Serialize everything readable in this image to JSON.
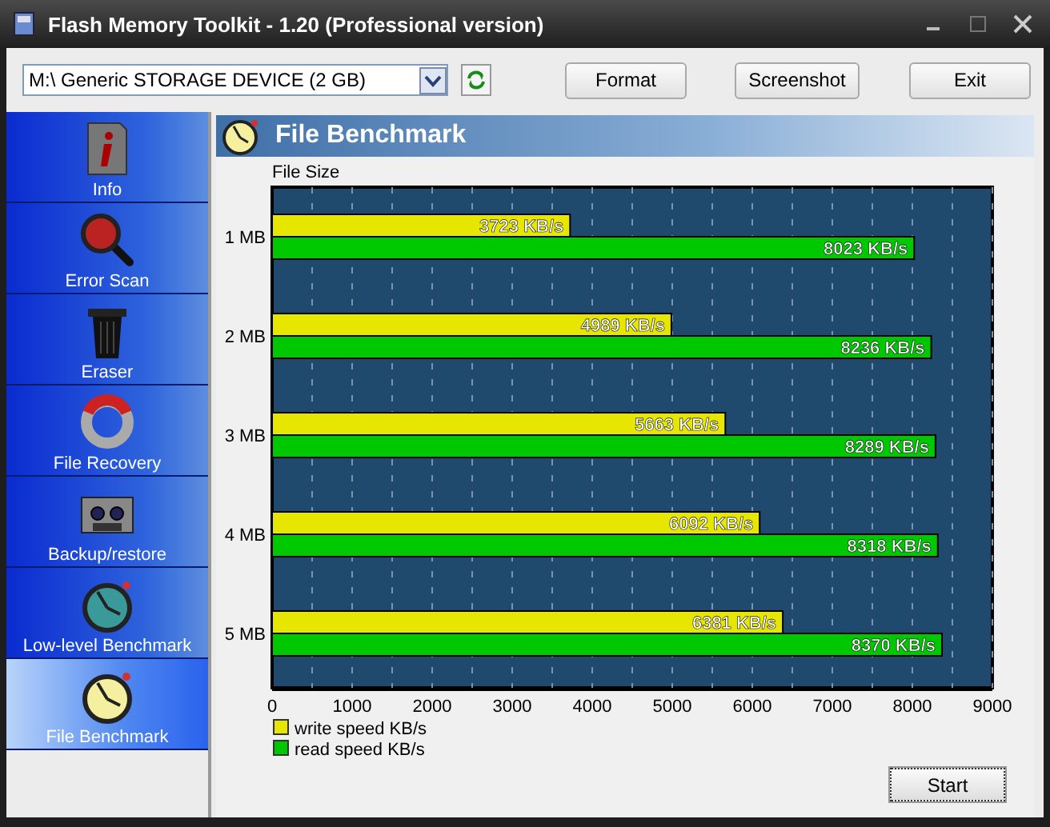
{
  "window": {
    "title": "Flash Memory Toolkit - 1.20 (Professional version)"
  },
  "toolbar": {
    "device": "M:\\ Generic STORAGE DEVICE (2 GB)",
    "buttons": [
      "Format",
      "Screenshot",
      "Exit"
    ]
  },
  "sidebar": {
    "items": [
      {
        "label": "Info",
        "selected": false
      },
      {
        "label": "Error Scan",
        "selected": false
      },
      {
        "label": "Eraser",
        "selected": false
      },
      {
        "label": "File Recovery",
        "selected": false
      },
      {
        "label": "Backup/restore",
        "selected": false
      },
      {
        "label": "Low-level Benchmark",
        "selected": false
      },
      {
        "label": "File Benchmark",
        "selected": true
      }
    ]
  },
  "panel": {
    "title": "File Benchmark",
    "chart_data": {
      "type": "bar",
      "orientation": "horizontal",
      "ylabel": "File Size",
      "categories": [
        "1 MB",
        "2 MB",
        "3 MB",
        "4 MB",
        "5 MB"
      ],
      "series": [
        {
          "name": "write speed KB/s",
          "color": "#e6e600",
          "values": [
            3723,
            4989,
            5663,
            6092,
            6381
          ]
        },
        {
          "name": "read speed KB/s",
          "color": "#00c800",
          "values": [
            8023,
            8236,
            8289,
            8318,
            8370
          ]
        }
      ],
      "value_labels": [
        [
          "3723 KB/s",
          "4989 KB/s",
          "5663 KB/s",
          "6092 KB/s",
          "6381 KB/s"
        ],
        [
          "8023 KB/s",
          "8236 KB/s",
          "8289 KB/s",
          "8318 KB/s",
          "8370 KB/s"
        ]
      ],
      "grid": true,
      "legend": true,
      "xlim": [
        0,
        9000
      ],
      "xticks": [
        0,
        1000,
        2000,
        3000,
        4000,
        5000,
        6000,
        7000,
        8000,
        9000
      ]
    },
    "start_button": "Start"
  }
}
